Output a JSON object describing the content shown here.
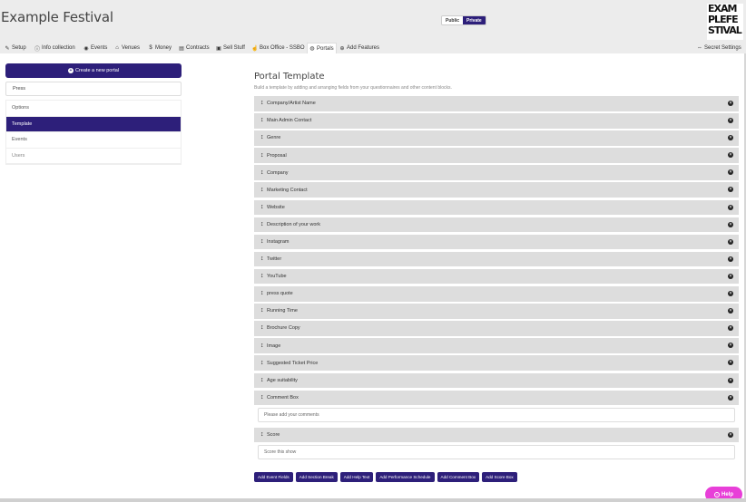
{
  "app": {
    "title": "Example Festival",
    "visibility": {
      "public_label": "Public",
      "private_label": "Private",
      "selected": "Private"
    },
    "logo_text": "EXAM PLEFE STIVAL"
  },
  "nav": {
    "items": [
      {
        "label": "Setup",
        "icon": "wrench-icon"
      },
      {
        "label": "Info collection",
        "icon": "info-icon"
      },
      {
        "label": "Events",
        "icon": "eye-icon"
      },
      {
        "label": "Venues",
        "icon": "home-icon"
      },
      {
        "label": "Money",
        "icon": "dollar-icon"
      },
      {
        "label": "Contracts",
        "icon": "document-icon"
      },
      {
        "label": "Sell Stuff",
        "icon": "box-icon"
      },
      {
        "label": "Box Office - SSBO",
        "icon": "thumbs-up-icon"
      },
      {
        "label": "Portals",
        "icon": "globe-icon",
        "active": true
      },
      {
        "label": "Add Features",
        "icon": "plus-circle-icon"
      }
    ],
    "secret_settings": {
      "label": "Secret Settings",
      "icon": "arrows-icon"
    }
  },
  "sidebar": {
    "create_button": "Create a new portal",
    "portal_select_value": "Press",
    "menu": [
      {
        "label": "Options",
        "active": false
      },
      {
        "label": "Template",
        "active": true
      },
      {
        "label": "Events",
        "active": false
      },
      {
        "label": "Users",
        "active": false
      }
    ]
  },
  "content": {
    "title": "Portal Template",
    "description": "Build a template by adding and arranging fields from your questionnaires and other content blocks.",
    "fields": [
      {
        "label": "Company/Artist Name"
      },
      {
        "label": "Main Admin Contact"
      },
      {
        "label": "Genre"
      },
      {
        "label": "Proposal"
      },
      {
        "label": "Company"
      },
      {
        "label": "Marketing Contact"
      },
      {
        "label": "Website"
      },
      {
        "label": "Description of your work"
      },
      {
        "label": "Instagram"
      },
      {
        "label": "Twitter"
      },
      {
        "label": "YouTube"
      },
      {
        "label": "press quote"
      },
      {
        "label": "Running Time"
      },
      {
        "label": "Brochure Copy"
      },
      {
        "label": "Image"
      },
      {
        "label": "Suggested Ticket Price"
      },
      {
        "label": "Age suitability"
      },
      {
        "label": "Comment Box",
        "input_placeholder": "Please add your comments"
      },
      {
        "label": "Score",
        "input_placeholder": "Score this show"
      }
    ],
    "add_buttons": [
      "Add Event Fields",
      "Add Section Break",
      "Add Help Text",
      "Add Performance Schedule",
      "Add Comment Box",
      "Add Score Box"
    ]
  },
  "help": {
    "label": "Help"
  },
  "colors": {
    "brand": "#2d1f7a",
    "help": "#e83fd8",
    "bar": "#dddddd"
  }
}
